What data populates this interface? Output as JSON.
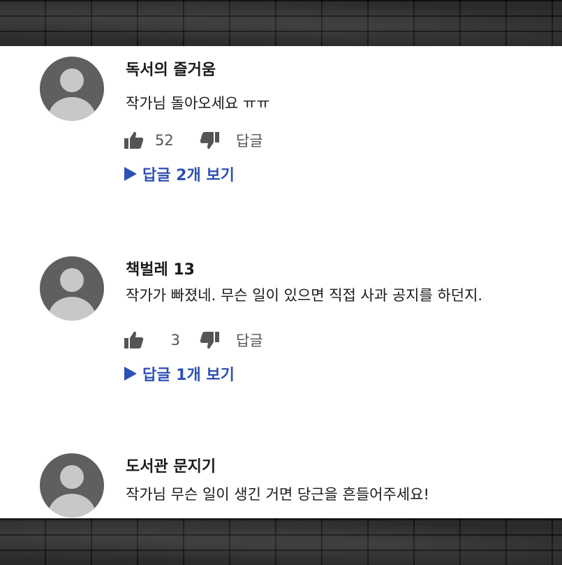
{
  "comments": [
    {
      "author": "독서의 즐거움",
      "text": "작가님 돌아오세요 ㅠㅠ",
      "likes": "52",
      "reply_label": "답글",
      "show_replies": "답글 2개 보기"
    },
    {
      "author": "책벌레 13",
      "text": "작가가 빠졌네. 무슨 일이 있으면 직접 사과 공지를 하던지.",
      "likes": "3",
      "reply_label": "답글",
      "show_replies": "답글 1개 보기"
    },
    {
      "author": "도서관 문지기",
      "text": "작가님 무슨 일이 생긴 거면 당근을 흔들어주세요!"
    }
  ],
  "icons": {
    "avatar": "user-avatar-icon",
    "like": "thumbs-up-icon",
    "dislike": "thumbs-down-icon",
    "expand": "play-triangle-icon"
  },
  "colors": {
    "link": "#2e4fb5",
    "avatar_bg": "#5f5f5f",
    "avatar_fg": "#c8c8c8",
    "icon": "#555555"
  }
}
